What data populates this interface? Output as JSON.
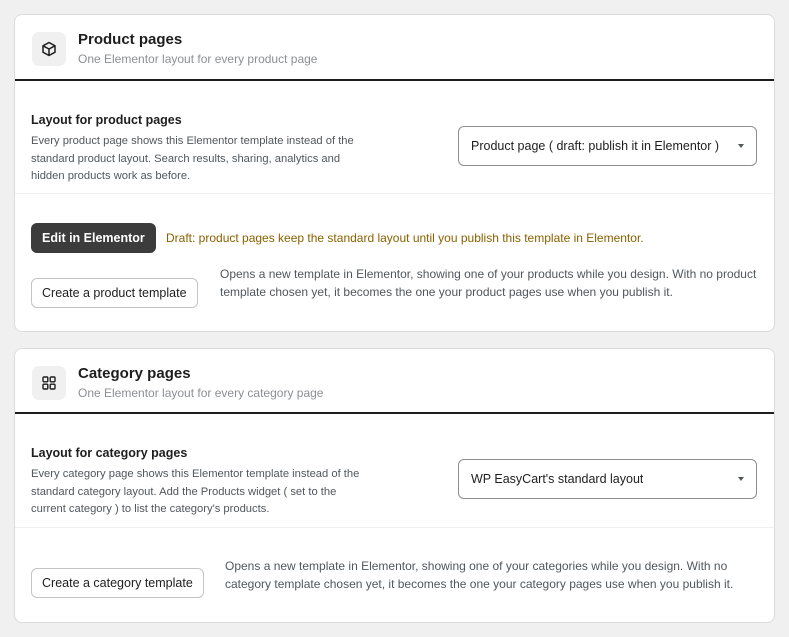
{
  "product": {
    "icon": "cube-icon",
    "title": "Product pages",
    "subtitle": "One Elementor layout for every product page",
    "layout_label": "Layout for product pages",
    "layout_desc": "Every product page shows this Elementor template instead of the standard product layout. Search results, sharing, analytics and hidden products work as before.",
    "select_value": "Product page ( draft: publish it in Elementor )",
    "edit_button": "Edit in Elementor",
    "draft_note": "Draft: product pages keep the standard layout until you publish this template in Elementor.",
    "create_button": "Create a product template",
    "help_text": "Opens a new template in Elementor, showing one of your products while you design. With no product template chosen yet, it becomes the one your product pages use when you publish it."
  },
  "category": {
    "icon": "grid-icon",
    "title": "Category pages",
    "subtitle": "One Elementor layout for every category page",
    "layout_label": "Layout for category pages",
    "layout_desc": "Every category page shows this Elementor template instead of the standard category layout. Add the Products widget ( set to the current category ) to list the category's products.",
    "select_value": "WP EasyCart's standard layout",
    "create_button": "Create a category template",
    "help_text": "Opens a new template in Elementor, showing one of your categories while you design. With no category template chosen yet, it becomes the one your category pages use when you publish it."
  },
  "colors": {
    "draft_note": "#8a6100",
    "dark_button": "#3c3c3c",
    "page_bg": "#f0f0f1"
  }
}
